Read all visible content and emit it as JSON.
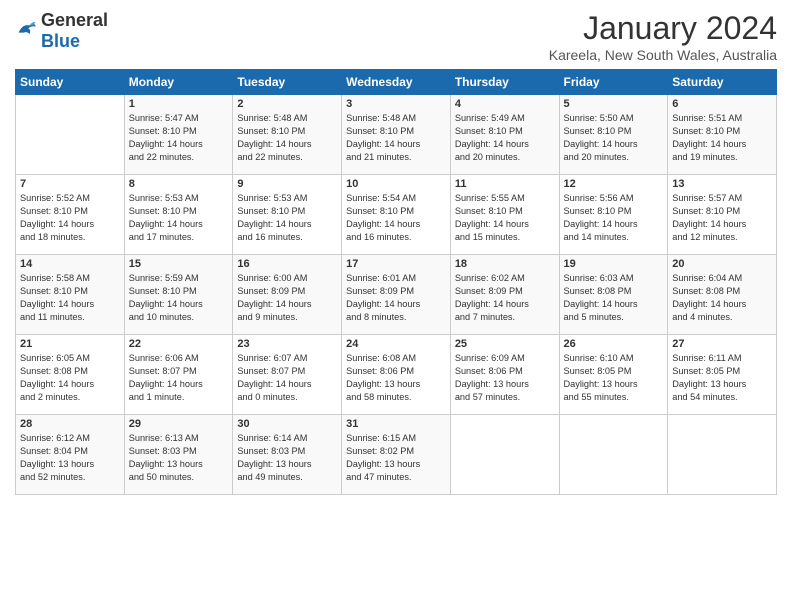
{
  "logo": {
    "text_general": "General",
    "text_blue": "Blue"
  },
  "header": {
    "month": "January 2024",
    "location": "Kareela, New South Wales, Australia"
  },
  "days_of_week": [
    "Sunday",
    "Monday",
    "Tuesday",
    "Wednesday",
    "Thursday",
    "Friday",
    "Saturday"
  ],
  "weeks": [
    [
      {
        "day": "",
        "info": ""
      },
      {
        "day": "1",
        "info": "Sunrise: 5:47 AM\nSunset: 8:10 PM\nDaylight: 14 hours\nand 22 minutes."
      },
      {
        "day": "2",
        "info": "Sunrise: 5:48 AM\nSunset: 8:10 PM\nDaylight: 14 hours\nand 22 minutes."
      },
      {
        "day": "3",
        "info": "Sunrise: 5:48 AM\nSunset: 8:10 PM\nDaylight: 14 hours\nand 21 minutes."
      },
      {
        "day": "4",
        "info": "Sunrise: 5:49 AM\nSunset: 8:10 PM\nDaylight: 14 hours\nand 20 minutes."
      },
      {
        "day": "5",
        "info": "Sunrise: 5:50 AM\nSunset: 8:10 PM\nDaylight: 14 hours\nand 20 minutes."
      },
      {
        "day": "6",
        "info": "Sunrise: 5:51 AM\nSunset: 8:10 PM\nDaylight: 14 hours\nand 19 minutes."
      }
    ],
    [
      {
        "day": "7",
        "info": "Sunrise: 5:52 AM\nSunset: 8:10 PM\nDaylight: 14 hours\nand 18 minutes."
      },
      {
        "day": "8",
        "info": "Sunrise: 5:53 AM\nSunset: 8:10 PM\nDaylight: 14 hours\nand 17 minutes."
      },
      {
        "day": "9",
        "info": "Sunrise: 5:53 AM\nSunset: 8:10 PM\nDaylight: 14 hours\nand 16 minutes."
      },
      {
        "day": "10",
        "info": "Sunrise: 5:54 AM\nSunset: 8:10 PM\nDaylight: 14 hours\nand 16 minutes."
      },
      {
        "day": "11",
        "info": "Sunrise: 5:55 AM\nSunset: 8:10 PM\nDaylight: 14 hours\nand 15 minutes."
      },
      {
        "day": "12",
        "info": "Sunrise: 5:56 AM\nSunset: 8:10 PM\nDaylight: 14 hours\nand 14 minutes."
      },
      {
        "day": "13",
        "info": "Sunrise: 5:57 AM\nSunset: 8:10 PM\nDaylight: 14 hours\nand 12 minutes."
      }
    ],
    [
      {
        "day": "14",
        "info": "Sunrise: 5:58 AM\nSunset: 8:10 PM\nDaylight: 14 hours\nand 11 minutes."
      },
      {
        "day": "15",
        "info": "Sunrise: 5:59 AM\nSunset: 8:10 PM\nDaylight: 14 hours\nand 10 minutes."
      },
      {
        "day": "16",
        "info": "Sunrise: 6:00 AM\nSunset: 8:09 PM\nDaylight: 14 hours\nand 9 minutes."
      },
      {
        "day": "17",
        "info": "Sunrise: 6:01 AM\nSunset: 8:09 PM\nDaylight: 14 hours\nand 8 minutes."
      },
      {
        "day": "18",
        "info": "Sunrise: 6:02 AM\nSunset: 8:09 PM\nDaylight: 14 hours\nand 7 minutes."
      },
      {
        "day": "19",
        "info": "Sunrise: 6:03 AM\nSunset: 8:08 PM\nDaylight: 14 hours\nand 5 minutes."
      },
      {
        "day": "20",
        "info": "Sunrise: 6:04 AM\nSunset: 8:08 PM\nDaylight: 14 hours\nand 4 minutes."
      }
    ],
    [
      {
        "day": "21",
        "info": "Sunrise: 6:05 AM\nSunset: 8:08 PM\nDaylight: 14 hours\nand 2 minutes."
      },
      {
        "day": "22",
        "info": "Sunrise: 6:06 AM\nSunset: 8:07 PM\nDaylight: 14 hours\nand 1 minute."
      },
      {
        "day": "23",
        "info": "Sunrise: 6:07 AM\nSunset: 8:07 PM\nDaylight: 14 hours\nand 0 minutes."
      },
      {
        "day": "24",
        "info": "Sunrise: 6:08 AM\nSunset: 8:06 PM\nDaylight: 13 hours\nand 58 minutes."
      },
      {
        "day": "25",
        "info": "Sunrise: 6:09 AM\nSunset: 8:06 PM\nDaylight: 13 hours\nand 57 minutes."
      },
      {
        "day": "26",
        "info": "Sunrise: 6:10 AM\nSunset: 8:05 PM\nDaylight: 13 hours\nand 55 minutes."
      },
      {
        "day": "27",
        "info": "Sunrise: 6:11 AM\nSunset: 8:05 PM\nDaylight: 13 hours\nand 54 minutes."
      }
    ],
    [
      {
        "day": "28",
        "info": "Sunrise: 6:12 AM\nSunset: 8:04 PM\nDaylight: 13 hours\nand 52 minutes."
      },
      {
        "day": "29",
        "info": "Sunrise: 6:13 AM\nSunset: 8:03 PM\nDaylight: 13 hours\nand 50 minutes."
      },
      {
        "day": "30",
        "info": "Sunrise: 6:14 AM\nSunset: 8:03 PM\nDaylight: 13 hours\nand 49 minutes."
      },
      {
        "day": "31",
        "info": "Sunrise: 6:15 AM\nSunset: 8:02 PM\nDaylight: 13 hours\nand 47 minutes."
      },
      {
        "day": "",
        "info": ""
      },
      {
        "day": "",
        "info": ""
      },
      {
        "day": "",
        "info": ""
      }
    ]
  ]
}
